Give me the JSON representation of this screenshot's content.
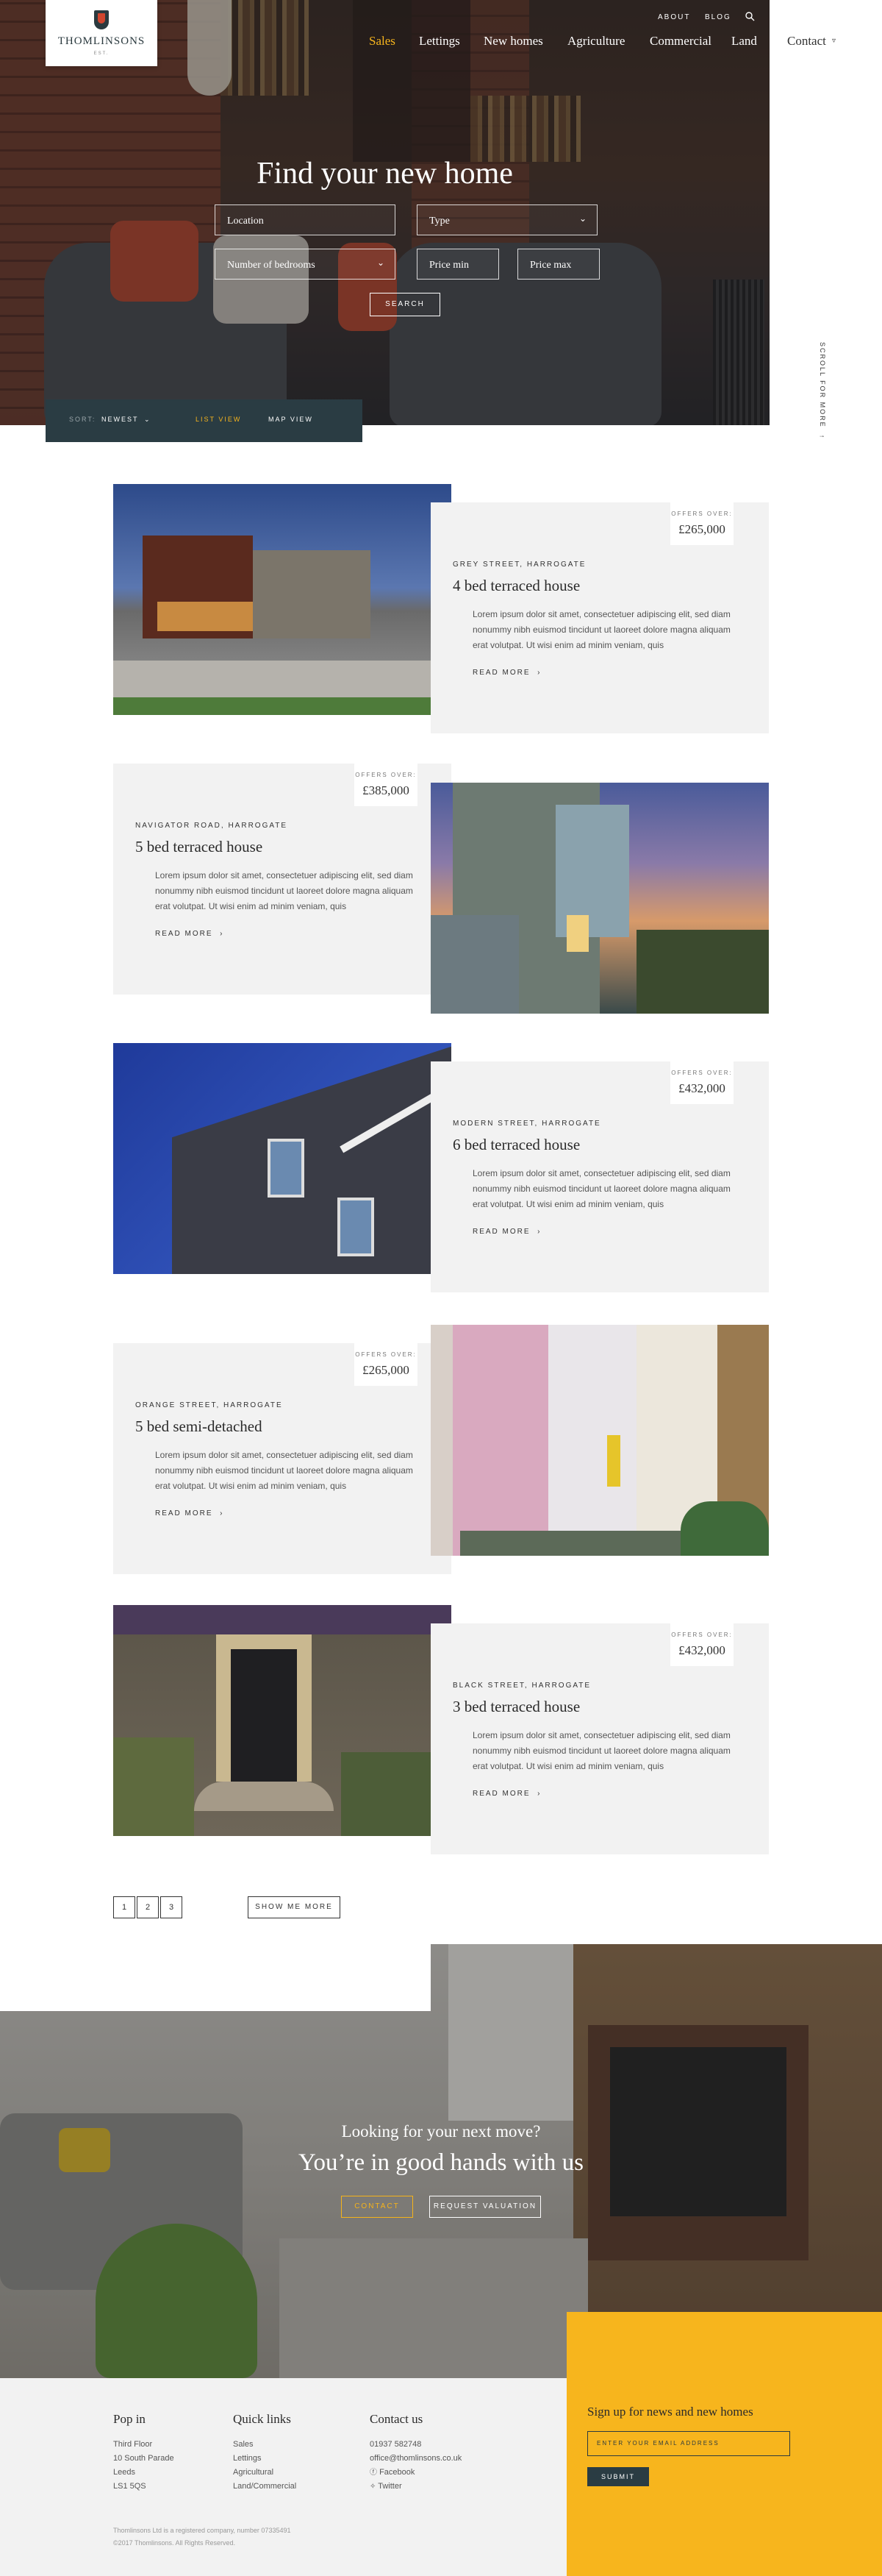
{
  "brand": {
    "name": "Thomlinsons",
    "tagline": "EST."
  },
  "topnav": {
    "about": "ABOUT",
    "blog": "BLOG"
  },
  "mainnav": {
    "items": [
      "Sales",
      "Lettings",
      "New homes",
      "Agriculture",
      "Commercial",
      "Land",
      "Contact"
    ]
  },
  "hero": {
    "title": "Find your new home",
    "location_placeholder": "Location",
    "type_placeholder": "Type",
    "bedrooms_placeholder": "Number of bedrooms",
    "price_min_placeholder": "Price min",
    "price_max_placeholder": "Price max",
    "search_label": "SEARCH"
  },
  "sort": {
    "label": "SORT:",
    "value": "NEWEST",
    "list_view": "LIST VIEW",
    "map_view": "MAP VIEW"
  },
  "scroll_hint": "SCROLL FOR MORE",
  "colors": {
    "accent": "#f7b51d",
    "dark": "#2a3c43",
    "card": "#f2f2f2"
  },
  "listings": [
    {
      "offers_label": "OFFERS OVER:",
      "price": "£265,000",
      "location": "GREY STREET, HARROGATE",
      "title": "4 bed terraced house",
      "description": "Lorem ipsum dolor sit amet, consectetuer adipiscing elit, sed diam nonummy nibh euismod tincidunt ut laoreet dolore magna aliquam erat volutpat. Ut wisi enim ad minim veniam, quis",
      "read_more": "READ MORE"
    },
    {
      "offers_label": "OFFERS OVER:",
      "price": "£385,000",
      "location": "NAVIGATOR ROAD, HARROGATE",
      "title": "5 bed terraced house",
      "description": "Lorem ipsum dolor sit amet, consectetuer adipiscing elit, sed diam nonummy nibh euismod tincidunt ut laoreet dolore magna aliquam erat volutpat. Ut wisi enim ad minim veniam, quis",
      "read_more": "READ MORE"
    },
    {
      "offers_label": "OFFERS OVER:",
      "price": "£432,000",
      "location": "MODERN STREET, HARROGATE",
      "title": "6 bed terraced house",
      "description": "Lorem ipsum dolor sit amet, consectetuer adipiscing elit, sed diam nonummy nibh euismod tincidunt ut laoreet dolore magna aliquam erat volutpat. Ut wisi enim ad minim veniam, quis",
      "read_more": "READ MORE"
    },
    {
      "offers_label": "OFFERS OVER:",
      "price": "£265,000",
      "location": "ORANGE STREET, HARROGATE",
      "title": "5 bed semi-detached",
      "description": "Lorem ipsum dolor sit amet, consectetuer adipiscing elit, sed diam nonummy nibh euismod tincidunt ut laoreet dolore magna aliquam erat volutpat. Ut wisi enim ad minim veniam, quis",
      "read_more": "READ MORE"
    },
    {
      "offers_label": "OFFERS OVER:",
      "price": "£432,000",
      "location": "BLACK STREET, HARROGATE",
      "title": "3 bed terraced house",
      "description": "Lorem ipsum dolor sit amet, consectetuer adipiscing elit, sed diam nonummy nibh euismod tincidunt ut laoreet dolore magna aliquam erat volutpat. Ut wisi enim ad minim veniam, quis",
      "read_more": "READ MORE"
    }
  ],
  "pagination": {
    "pages": [
      "1",
      "2",
      "3"
    ],
    "show_more": "SHOW ME MORE"
  },
  "cta": {
    "kicker": "Looking for your next move?",
    "title": "You’re in good hands with us",
    "contact": "CONTACT",
    "valuation": "REQUEST VALUATION"
  },
  "footer": {
    "popin": {
      "heading": "Pop in",
      "lines": [
        "Third Floor",
        "10 South Parade",
        "Leeds",
        "LS1 5QS"
      ]
    },
    "quick": {
      "heading": "Quick links",
      "links": [
        "Sales",
        "Lettings",
        "Agricultural",
        "Land/Commercial"
      ]
    },
    "contact": {
      "heading": "Contact us",
      "phone": "01937 582748",
      "email": "office@thomlinsons.co.uk",
      "facebook": "Facebook",
      "twitter": "Twitter"
    },
    "legal1": "Thomlinsons Ltd is a registered company, number 07335491",
    "legal2": "©2017 Thomlinsons. All Rights Reserved."
  },
  "signup": {
    "heading": "Sign up for news and new homes",
    "placeholder": "ENTER YOUR EMAIL ADDRESS",
    "submit": "SUBMIT"
  }
}
